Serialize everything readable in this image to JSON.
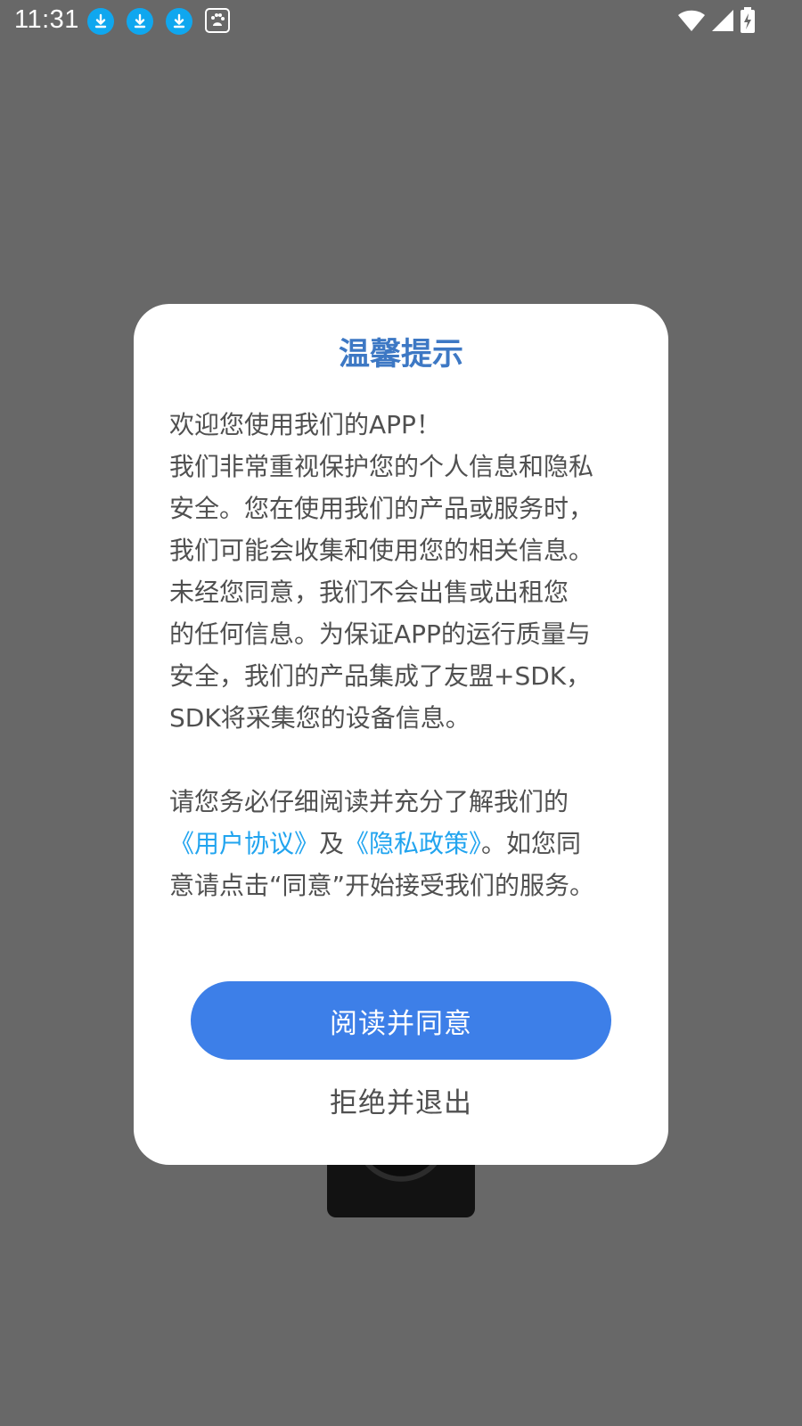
{
  "status_bar": {
    "time": "11:31",
    "notification_icons": [
      "download-icon",
      "download-icon",
      "download-icon",
      "baidu-app-icon"
    ],
    "system_icons": [
      "wifi-icon",
      "cell-signal-icon",
      "battery-charging-icon"
    ]
  },
  "dialog": {
    "title": "温馨提示",
    "paragraph1": [
      "欢迎您使用我们的APP！",
      "我们非常重视保护您的个人信息和隐私",
      "安全。您在使用我们的产品或服务时，",
      "我们可能会收集和使用您的相关信息。",
      "未经您同意，我们不会出售或出租您",
      "的任何信息。为保证APP的运行质量与",
      "安全，我们的产品集成了友盟+SDK，",
      "SDK将采集您的设备信息。"
    ],
    "paragraph2": {
      "line1": "请您务必仔细阅读并充分了解我们的",
      "user_agreement_link": "《用户协议》",
      "and": "及",
      "privacy_policy_link": "《隐私政策》",
      "line2_tail": "。如您同",
      "line3": "意请点击“同意”开始接受我们的服务。"
    },
    "agree_button": "阅读并同意",
    "reject_button": "拒绝并退出"
  },
  "colors": {
    "overlay": "#686868",
    "title": "#3d78c4",
    "link": "#21a4ef",
    "primary_button": "#3d7fe8",
    "body_text": "#505050",
    "download_badge": "#0fa7ef"
  }
}
